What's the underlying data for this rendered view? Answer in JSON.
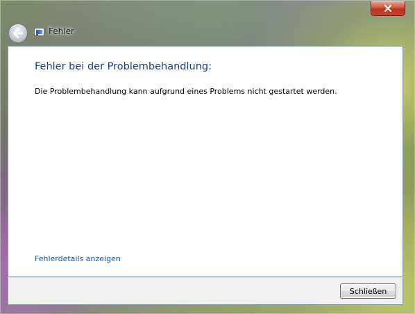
{
  "window": {
    "title": "Fehler",
    "close_icon": "close-icon",
    "back_icon": "back-arrow-icon",
    "app_icon": "troubleshooting-icon",
    "close_button_color": "#c7482e"
  },
  "content": {
    "heading": "Fehler bei der Problembehandlung:",
    "message": "Die Problembehandlung kann aufgrund eines Problems nicht gestartet werden.",
    "details_link": "Fehlerdetails anzeigen",
    "heading_color": "#1e3a8c",
    "link_color": "#1a55a8"
  },
  "footer": {
    "close_label": "Schließen"
  }
}
